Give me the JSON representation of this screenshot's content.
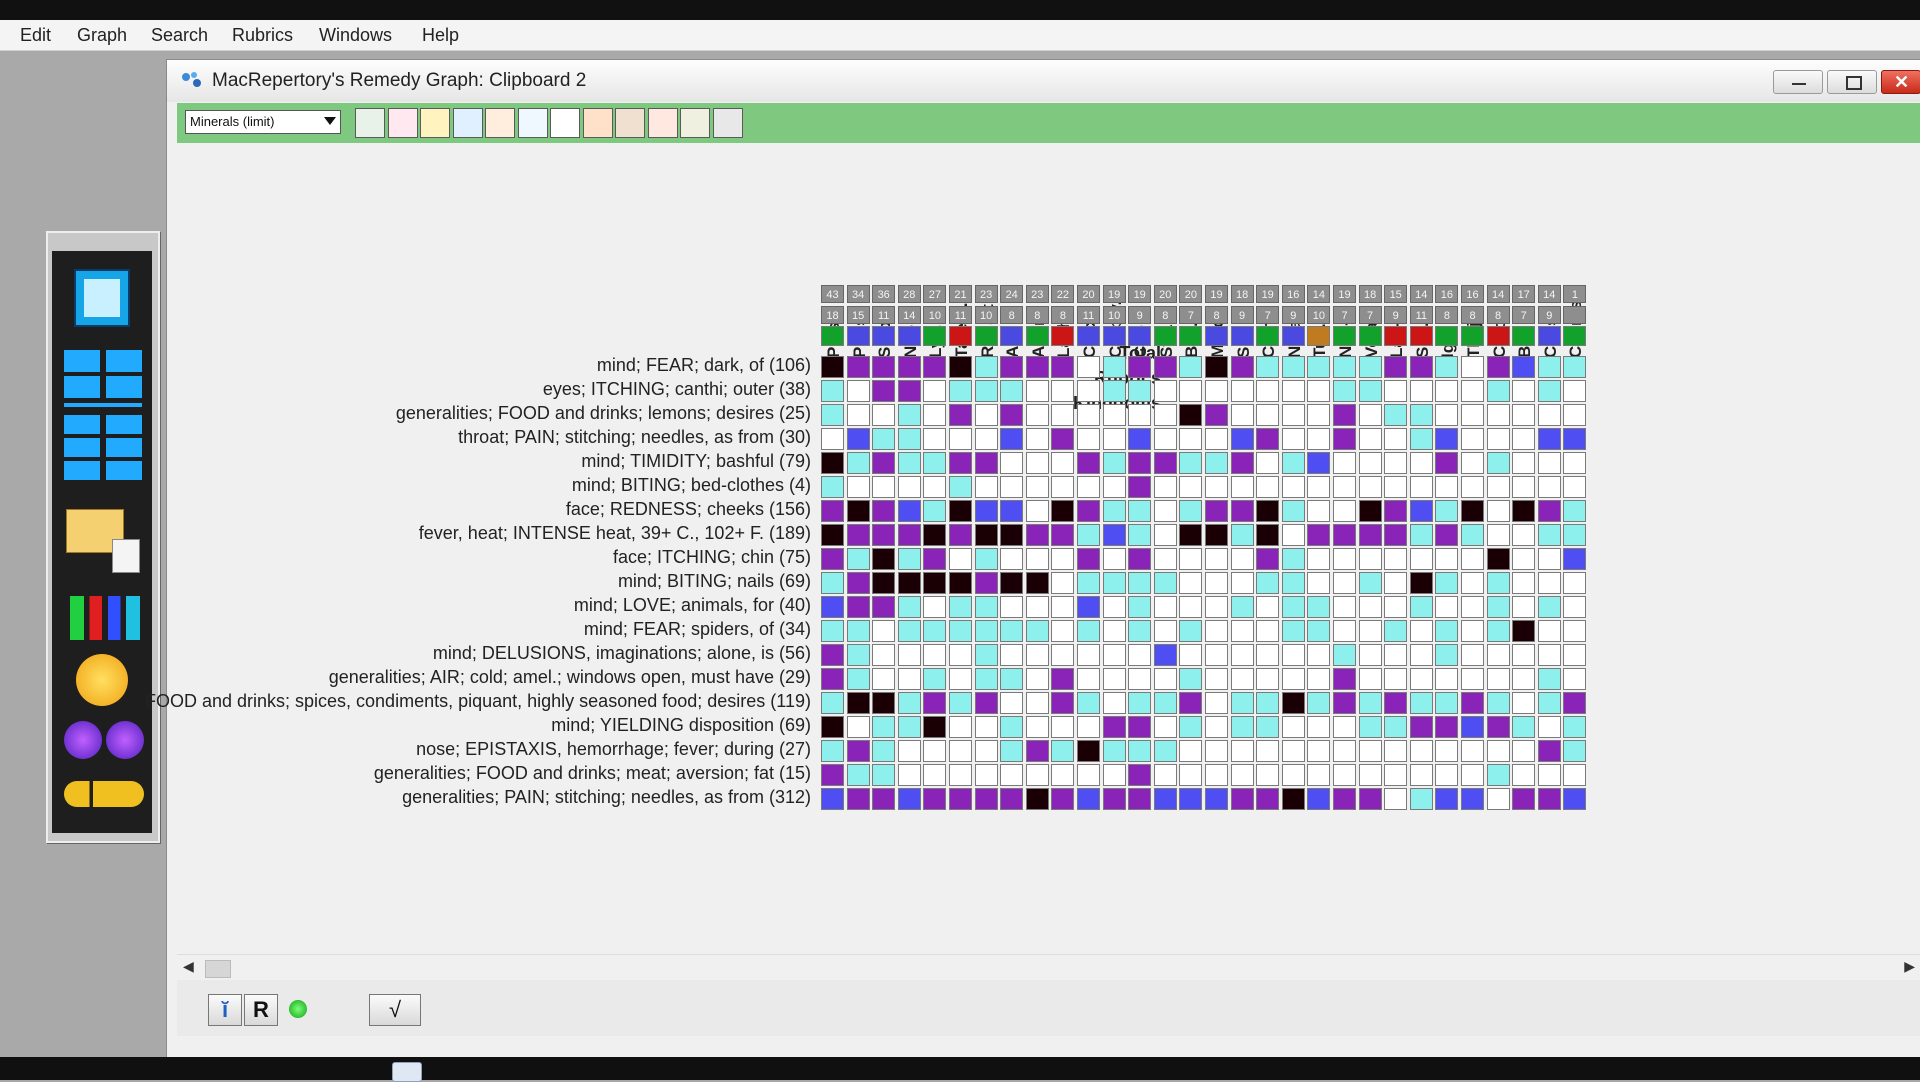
{
  "menu": [
    "Edit",
    "Graph",
    "Search",
    "Rubrics",
    "Windows",
    "Help"
  ],
  "window": {
    "title": "MacRepertory's Remedy Graph: Clipboard 2"
  },
  "toolbar": {
    "dropdown": "Minerals (limit)",
    "icons": [
      "grid-view-icon",
      "circles-icon",
      "color-grid-icon",
      "bar-view-icon",
      "bars-icon",
      "scatter-icon",
      "diamond-icon",
      "face-icon",
      "snake-icon",
      "animal-icon",
      "stripes-icon",
      "figure-icon"
    ]
  },
  "headers": {
    "total": "Total",
    "rubrics": "Rubrics",
    "kingdoms": "Kingdoms"
  },
  "remedies": [
    "Puls.",
    "Phos.",
    "Sulph.",
    "Nat-m.",
    "Lyc.",
    "Tarent.",
    "Rhus-t.",
    "Ars.",
    "Acon.",
    "Lach.",
    "Calc.",
    "Carb-v.",
    "Cupr.",
    "Stram.",
    "Bell.",
    "Merc.",
    "Sil.",
    "Chin.",
    "Nit-ac.",
    "Tub.",
    "Nux-v.",
    "Verat.",
    "Lac-c.",
    "Sep.",
    "Ign.",
    "Thuj.",
    "Carc.",
    "Bry.",
    "Caust.",
    "Cann-s."
  ],
  "totals": [
    "43",
    "34",
    "36",
    "28",
    "27",
    "21",
    "23",
    "24",
    "23",
    "22",
    "20",
    "19",
    "19",
    "20",
    "20",
    "19",
    "18",
    "19",
    "16",
    "14",
    "19",
    "18",
    "15",
    "14",
    "16",
    "16",
    "14",
    "17",
    "14",
    "1"
  ],
  "rubric_counts": [
    "18",
    "15",
    "11",
    "14",
    "10",
    "11",
    "10",
    "8",
    "8",
    "8",
    "11",
    "10",
    "9",
    "8",
    "7",
    "8",
    "9",
    "7",
    "9",
    "10",
    "7",
    "7",
    "9",
    "11",
    "8",
    "8",
    "8",
    "7",
    "9",
    ""
  ],
  "kingdoms": [
    "G",
    "B",
    "B",
    "B",
    "G",
    "R",
    "G",
    "B",
    "G",
    "R",
    "B",
    "B",
    "B",
    "G",
    "G",
    "B",
    "B",
    "G",
    "B",
    "O",
    "G",
    "G",
    "R",
    "R",
    "G",
    "G",
    "R",
    "G",
    "B",
    "G"
  ],
  "kingdom_colors": {
    "G": "#12a12a",
    "B": "#4a4ae0",
    "R": "#cc1616",
    "O": "#c07a20"
  },
  "cell_colors": {
    "0": "#ffffff",
    "1": "#8ef0ec",
    "2": "#4e4ef2",
    "3": "#8a24b8",
    "4": "#1a0004"
  },
  "rubrics": [
    {
      "label": "mind; FEAR; dark, of (106)",
      "cells": "433334133301331431111133103211"
    },
    {
      "label": "eyes; ITCHING; canthi; outer (38)",
      "cells": "103301110001100000001100001010"
    },
    {
      "label": "generalities; FOOD and drinks; lemons; desires (25)",
      "cells": "100103030000004300003011000000"
    },
    {
      "label": "throat; PAIN; stitching; needles, as from (30)",
      "cells": "021100020300200023003001200022"
    },
    {
      "label": "mind; TIMIDITY; bashful (79)",
      "cells": "413113300031331130120000301000"
    },
    {
      "label": "mind; BITING; bed-clothes (4)",
      "cells": "100001000000300000000000000000"
    },
    {
      "label": "face; REDNESS; cheeks (156)",
      "cells": "343214220431101334100432140431"
    },
    {
      "label": "fever, heat; INTENSE heat, 39+ C., 102+ F. (189)",
      "cells": "433343443312104414033331310011"
    },
    {
      "label": "face; ITCHING; chin (75)",
      "cells": "314130100030300003100000004002"
    },
    {
      "label": "mind; BITING; nails (69)",
      "cells": "134444344011110001100104101000"
    },
    {
      "label": "mind; LOVE; animals, for (40)",
      "cells": "233101100020100010110001001010"
    },
    {
      "label": "mind; FEAR; spiders, of (34)",
      "cells": "110111111010101000110010101400"
    },
    {
      "label": "mind; DELUSIONS, imaginations; alone, is (56)",
      "cells": "310000100000020000001000100000"
    },
    {
      "label": "generalities; AIR; cold; amel.; windows open, must have (29)",
      "cells": "310010110300001000003000000010"
    },
    {
      "label": "FOOD and drinks; spices, condiments, piquant, highly seasoned food; desires (119)",
      "cells": "144131300310113011413131131013"
    },
    {
      "label": "mind; YIELDING disposition (69)",
      "cells": "401140010003301011000113323101"
    },
    {
      "label": "nose; EPISTAXIS, hemorrhage; fever; during (27)",
      "cells": "131000013141110000000000000031"
    },
    {
      "label": "generalities; FOOD and drinks; meat; aversion; fat (15)",
      "cells": "311000000000300000000000001000"
    },
    {
      "label": "generalities; PAIN; stitching; needles, as from (312)",
      "cells": "233233334323322233423301220332"
    }
  ],
  "status": {
    "btn1": "ĭ",
    "btn2": "R",
    "btn4": "√"
  }
}
